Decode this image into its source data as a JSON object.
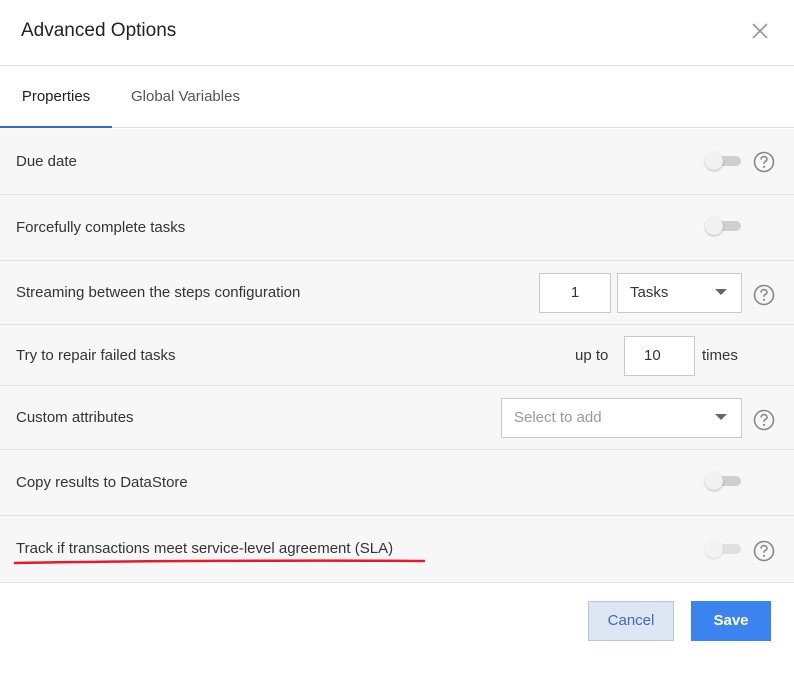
{
  "dialog": {
    "title": "Advanced Options"
  },
  "tabs": [
    {
      "label": "Properties",
      "active": true
    },
    {
      "label": "Global Variables",
      "active": false
    }
  ],
  "rows": {
    "due_date": {
      "label": "Due date",
      "enabled": false
    },
    "force_complete": {
      "label": "Forcefully complete tasks",
      "enabled": false
    },
    "streaming": {
      "label": "Streaming between the steps configuration",
      "count": "1",
      "unit": "Tasks"
    },
    "repair": {
      "label": "Try to repair failed tasks",
      "prefix": "up to",
      "value": "10",
      "suffix": "times"
    },
    "custom_attributes": {
      "label": "Custom attributes",
      "placeholder": "Select to add"
    },
    "copy_results": {
      "label": "Copy results to DataStore",
      "enabled": false
    },
    "sla": {
      "label": "Track if transactions meet service-level agreement (SLA)",
      "enabled": false
    }
  },
  "footer": {
    "cancel_label": "Cancel",
    "save_label": "Save"
  },
  "colors": {
    "accent": "#3b84f0",
    "tab_indicator": "#2a6fc9",
    "annotation": "#e8192c"
  },
  "icons": {
    "close": "close-icon",
    "help": "help-icon"
  }
}
